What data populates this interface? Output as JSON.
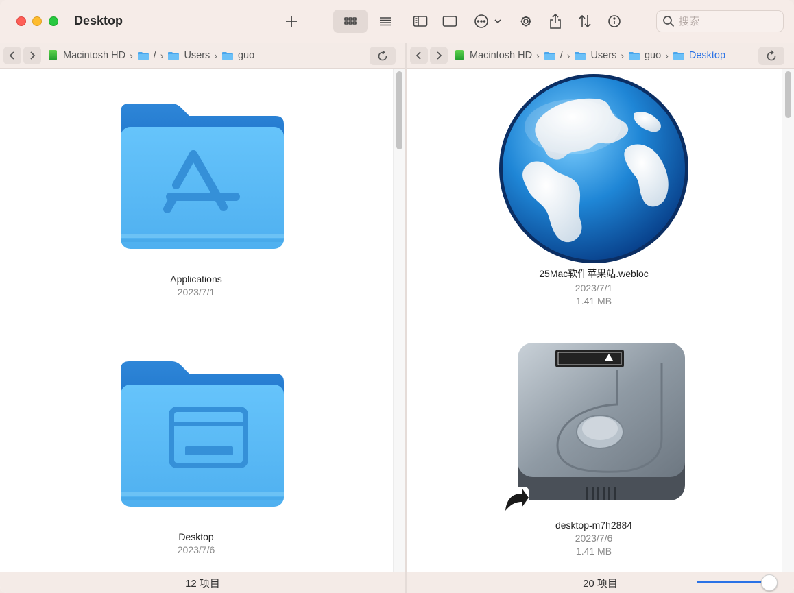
{
  "window": {
    "title": "Desktop"
  },
  "toolbar": {
    "buttons": [
      "add-icon",
      "icon-view-icon",
      "list-view-icon",
      "sidebar-icon",
      "preview-icon",
      "more-icon",
      "gear-icon",
      "share-icon",
      "sort-icon",
      "info-icon"
    ],
    "search_placeholder": "搜索"
  },
  "left_pane": {
    "path": [
      {
        "label": "Macintosh HD",
        "icon": "hard-drive-icon"
      },
      {
        "label": "/",
        "icon": "folder-icon"
      },
      {
        "label": "Users",
        "icon": "folder-icon"
      },
      {
        "label": "guo",
        "icon": "folder-icon"
      }
    ],
    "items": [
      {
        "name": "Applications",
        "date": "2023/7/1",
        "icon": "applications-folder-icon"
      },
      {
        "name": "Desktop",
        "date": "2023/7/6",
        "icon": "desktop-folder-icon"
      }
    ],
    "status": "12 项目",
    "scroll_fraction": 0.0
  },
  "right_pane": {
    "path": [
      {
        "label": "Macintosh HD",
        "icon": "hard-drive-icon"
      },
      {
        "label": "/",
        "icon": "folder-icon"
      },
      {
        "label": "Users",
        "icon": "folder-icon"
      },
      {
        "label": "guo",
        "icon": "folder-icon"
      },
      {
        "label": "Desktop",
        "icon": "folder-icon"
      }
    ],
    "items": [
      {
        "name": "25Mac软件苹果站.webloc",
        "date": "2023/7/1",
        "size": "1.41 MB",
        "icon": "globe-icon"
      },
      {
        "name": "desktop-m7h2884",
        "date": "2023/7/6",
        "size": "1.41 MB",
        "icon": "hard-disk-alias-icon"
      }
    ],
    "status": "20 项目",
    "zoom_level": 1.0
  },
  "colors": {
    "accent": "#2a72e6",
    "folder": "#5ab8f5",
    "window_bg": "#f6ece8"
  }
}
